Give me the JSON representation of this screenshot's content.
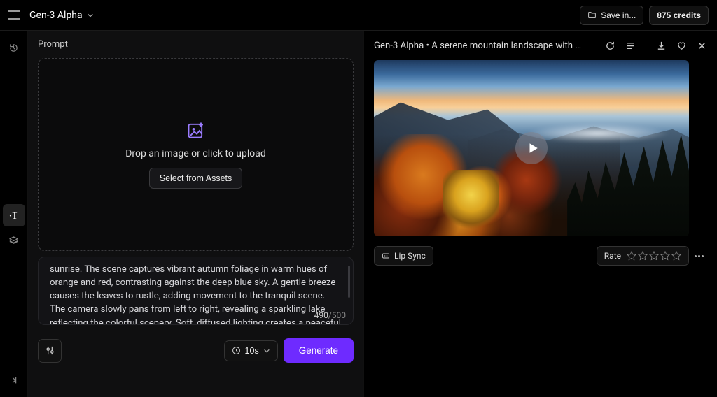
{
  "topbar": {
    "model": "Gen-3 Alpha",
    "save_label": "Save in...",
    "credits_label": "875 credits"
  },
  "left": {
    "section_label": "Prompt",
    "dropzone_text": "Drop an image or click to upload",
    "assets_btn": "Select from Assets",
    "prompt_text": "sunrise. The scene captures vibrant autumn foliage in warm hues of orange and red, contrasting against the deep blue sky. A gentle breeze causes the leaves to rustle, adding movement to the tranquil scene. The camera slowly pans from left to right, revealing a sparkling lake reflecting the colorful scenery. Soft, diffused lighting creates a peaceful and",
    "char_count": "490",
    "char_max": "/500",
    "duration_label": "10s",
    "generate_label": "Generate"
  },
  "right": {
    "title": "Gen-3 Alpha • A serene mountain landscape with rol...",
    "lip_sync_label": "Lip Sync",
    "rate_label": "Rate"
  }
}
